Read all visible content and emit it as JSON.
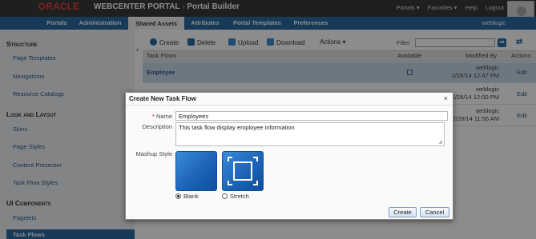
{
  "header": {
    "logo_text": "ORACLE",
    "product": "WEBCENTER PORTAL",
    "separator": "›",
    "app": "Portal Builder",
    "links": [
      "Portals ▾",
      "Favorites ▾",
      "Help",
      "Logout"
    ]
  },
  "nav": {
    "tabs": [
      "Portals",
      "Administration",
      "Shared Assets",
      "Attributes",
      "Portal Templates",
      "Preferences"
    ],
    "active_tab": "Shared Assets",
    "user": "weblogic"
  },
  "sidebar": {
    "sections": [
      {
        "title": "Structure",
        "items": [
          "Page Templates",
          "Navigations",
          "Resource Catalogs"
        ]
      },
      {
        "title": "Look and Layout",
        "items": [
          "Skins",
          "Page Styles",
          "Content Presenter",
          "Task Flow Styles"
        ]
      },
      {
        "title": "UI Components",
        "items": [
          "Pagelets",
          "Task Flows"
        ]
      }
    ],
    "selected_item": "Task Flows"
  },
  "toolbar": {
    "create": "Create",
    "delete": "Delete",
    "upload": "Upload",
    "download": "Download",
    "actions": "Actions ▾",
    "filter_label": "Filter",
    "filter_go": "➡"
  },
  "table": {
    "columns": [
      "Task Flows",
      "Available",
      "Modified By",
      "Actions"
    ],
    "rows": [
      {
        "name": "Employee",
        "user": "weblogic",
        "date": "2/28/14 12:47 PM",
        "action": "Edit",
        "selected": true
      },
      {
        "name": "",
        "user": "weblogic",
        "date": "2/28/14 12:00 PM",
        "action": "Edit",
        "selected": false
      },
      {
        "name": "",
        "user": "weblogic",
        "date": "2/28/14 11:56 AM",
        "action": "Edit",
        "selected": false
      }
    ]
  },
  "dialog": {
    "title": "Create New Task Flow",
    "close": "×",
    "name_label": "Name",
    "required_mark": "*",
    "name_value": "Employees",
    "description_label": "Description",
    "description_value": "This task flow display employee information",
    "mashup_label": "Mashup Style",
    "styles": [
      {
        "label": "Blank",
        "checked": true
      },
      {
        "label": "Stretch",
        "checked": false
      }
    ],
    "create_button": "Create",
    "cancel_button": "Cancel"
  },
  "colors": {
    "nav_blue": "#2d6aa3",
    "tile_blue": "#1b64b8",
    "oracle_red": "#e0463d"
  }
}
